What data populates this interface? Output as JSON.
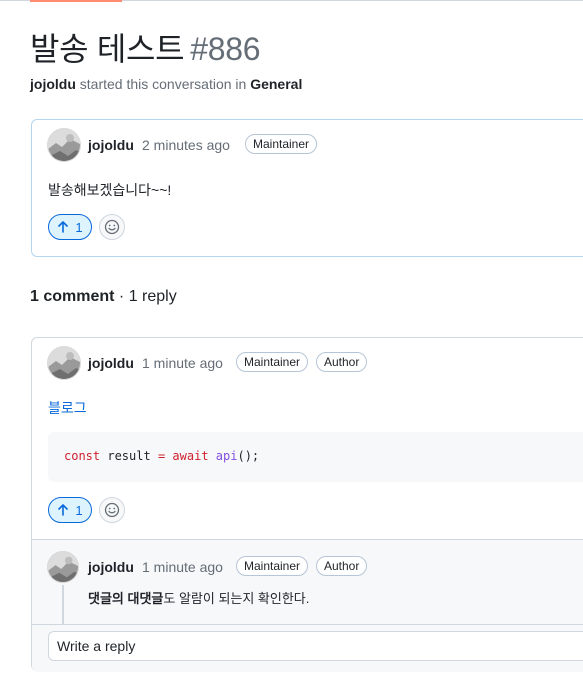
{
  "discussion": {
    "title": "발송 테스트",
    "number": "#886",
    "meta": {
      "author": "jojoldu",
      "middle_text": "started this conversation in",
      "category": "General"
    }
  },
  "op_post": {
    "author": "jojoldu",
    "time": "2 minutes ago",
    "badges": [
      "Maintainer"
    ],
    "body": "발송해보겠습니다~~!",
    "reaction_count": "1"
  },
  "comments_summary": {
    "comments": "1 comment",
    "separator": "·",
    "replies": "1 reply"
  },
  "comment": {
    "author": "jojoldu",
    "time": "1 minute ago",
    "badges": [
      "Maintainer",
      "Author"
    ],
    "link_text": "블로그",
    "code": {
      "kw1": "const",
      "var": "result",
      "op": "=",
      "kw2": "await",
      "fn": "api",
      "tail": "();"
    },
    "reaction_count": "1"
  },
  "reply": {
    "author": "jojoldu",
    "time": "1 minute ago",
    "badges": [
      "Maintainer",
      "Author"
    ],
    "body_bold": "댓글의 대댓글",
    "body_rest": "도 알람이 되는지 확인한다."
  },
  "reply_input": {
    "placeholder": "Write a reply"
  },
  "icons": {
    "reaction": "arrow-up-icon",
    "emoji": "smiley-icon",
    "avatar": "avatar-image"
  },
  "colors": {
    "accent_link": "#0969da",
    "reaction_bg": "#ddf4ff",
    "code_keyword": "#cf222e",
    "code_function": "#8250df",
    "tab_underline": "#fd8c73"
  }
}
